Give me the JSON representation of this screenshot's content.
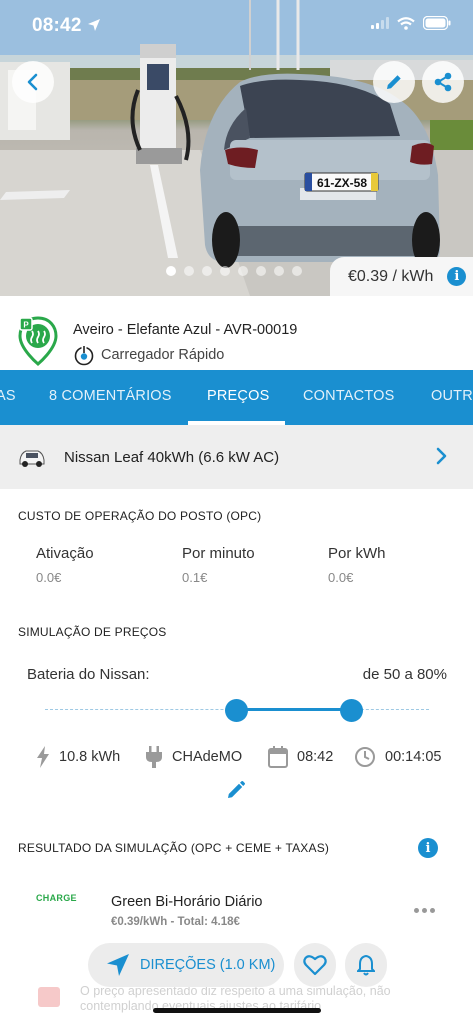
{
  "status_bar": {
    "time": "08:42"
  },
  "hero": {
    "photo_count": 8,
    "active_photo": 1,
    "price": "€0.39 / kWh",
    "plate": "61-ZX-58"
  },
  "station": {
    "name": "Aveiro - Elefante Azul - AVR-00019",
    "type": "Carregador Rápido"
  },
  "tabs": {
    "items": [
      "AS",
      "8 COMENTÁRIOS",
      "PREÇOS",
      "CONTACTOS",
      "OUTR"
    ],
    "active": "PREÇOS"
  },
  "vehicle": {
    "name": "Nissan Leaf 40kWh (6.6 kW AC)"
  },
  "opc": {
    "title": "CUSTO DE OPERAÇÃO DO POSTO (OPC)",
    "columns": [
      {
        "label": "Ativação",
        "value": "0.0€"
      },
      {
        "label": "Por minuto",
        "value": "0.1€"
      },
      {
        "label": "Por kWh",
        "value": "0.0€"
      }
    ]
  },
  "simulation": {
    "title": "SIMULAÇÃO DE PREÇOS",
    "battery_label": "Bateria do Nissan:",
    "battery_range": "de 50 a 80%",
    "battery_from_percent": 50,
    "battery_to_percent": 80,
    "energy": "10.8 kWh",
    "connector": "CHAdeMO",
    "start_time": "08:42",
    "duration": "00:14:05"
  },
  "result": {
    "title": "RESULTADO DA SIMULAÇÃO (OPC + CEME + TAXAS)",
    "provider_logo": "CHARGE",
    "provider_name": "Green Bi-Horário Diário",
    "provider_price": "€0.39/kWh  - Total: 4.18€"
  },
  "actions": {
    "directions": "DIREÇÕES (1.0 KM)"
  },
  "disclaimer": "O preço apresentado diz respeito a uma simulação, não contemplando eventuais ajustes ao tarifário"
}
